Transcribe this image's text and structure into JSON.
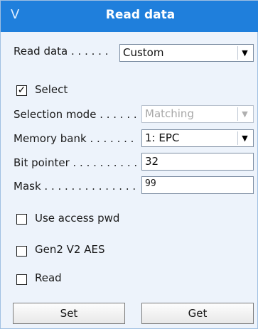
{
  "header": {
    "title": "Read data",
    "collapse_glyph": "V"
  },
  "read_data": {
    "label": "Read data . . . . . .",
    "value": "Custom"
  },
  "select": {
    "label": "Select",
    "checked": true
  },
  "selection_mode": {
    "label": "Selection mode . . . . . .",
    "value": "Matching"
  },
  "memory_bank": {
    "label": "Memory bank . . . . . . .",
    "value": "1: EPC"
  },
  "bit_pointer": {
    "label": "Bit pointer . . . . . . . . . .",
    "value": "32"
  },
  "mask": {
    "label": "Mask . . . . . . . . . . . . . .",
    "value": "99"
  },
  "options": {
    "use_access_pwd": "Use access pwd",
    "gen2_v2_aes": "Gen2 V2 AES",
    "read": "Read"
  },
  "buttons": {
    "set": "Set",
    "get": "Get"
  },
  "colors": {
    "header": "#1f7fdc",
    "panel": "#edf3fb"
  }
}
